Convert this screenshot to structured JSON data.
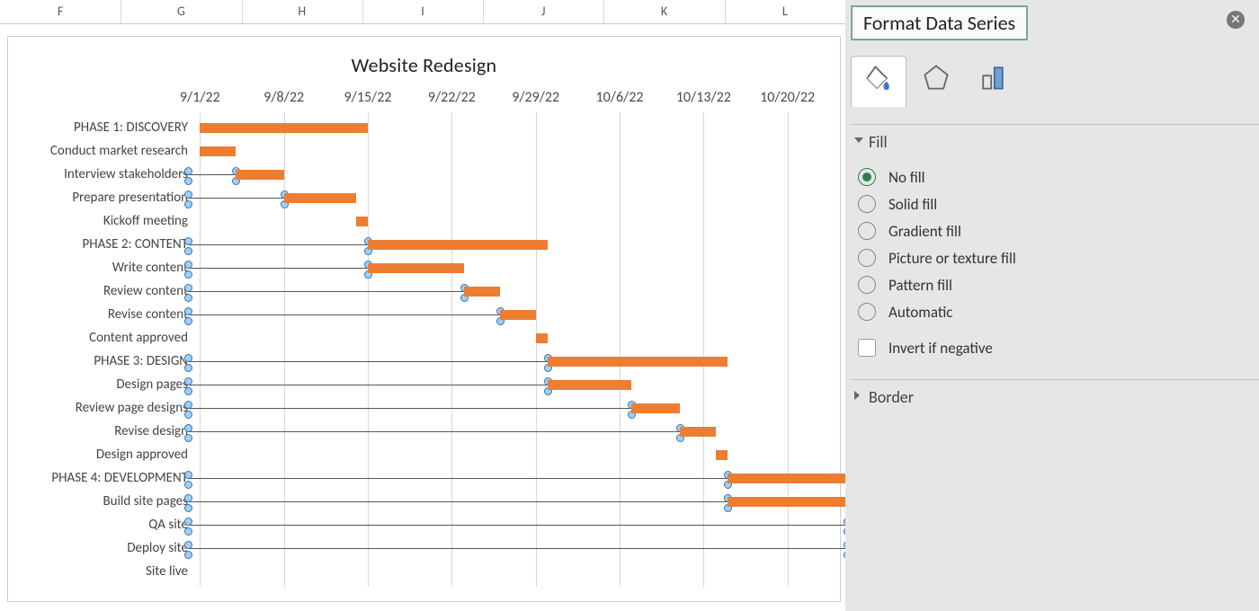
{
  "columns": [
    "F",
    "G",
    "H",
    "I",
    "J",
    "K",
    "L"
  ],
  "panel": {
    "title": "Format Data Series",
    "sections": {
      "fill": "Fill",
      "border": "Border"
    },
    "fill_options": [
      "No fill",
      "Solid fill",
      "Gradient fill",
      "Picture or texture fill",
      "Pattern fill",
      "Automatic"
    ],
    "fill_selected": 0,
    "invert": "Invert if negative"
  },
  "chart_data": {
    "type": "bar",
    "title": "Website Redesign",
    "xlabel": "",
    "ylabel": "",
    "x_ticks": [
      "9/1/22",
      "9/8/22",
      "9/15/22",
      "9/22/22",
      "9/29/22",
      "10/6/22",
      "10/13/22",
      "10/20/22"
    ],
    "x_range": [
      "2022-08-31",
      "2022-10-24"
    ],
    "tasks": [
      {
        "name": "PHASE 1: DISCOVERY",
        "start": "2022-09-01",
        "days": 14,
        "lead": false
      },
      {
        "name": "Conduct market research",
        "start": "2022-09-01",
        "days": 3,
        "lead": false
      },
      {
        "name": "Interview stakeholders",
        "start": "2022-09-04",
        "days": 4,
        "lead": true
      },
      {
        "name": "Prepare presentation",
        "start": "2022-09-08",
        "days": 6,
        "lead": true
      },
      {
        "name": "Kickoff meeting",
        "start": "2022-09-14",
        "days": 1,
        "lead": false
      },
      {
        "name": "PHASE 2: CONTENT",
        "start": "2022-09-15",
        "days": 15,
        "lead": true
      },
      {
        "name": "Write content",
        "start": "2022-09-15",
        "days": 8,
        "lead": true
      },
      {
        "name": "Review content",
        "start": "2022-09-23",
        "days": 3,
        "lead": true
      },
      {
        "name": "Revise content",
        "start": "2022-09-26",
        "days": 3,
        "lead": true
      },
      {
        "name": "Content approved",
        "start": "2022-09-29",
        "days": 1,
        "lead": false
      },
      {
        "name": "PHASE 3: DESIGN",
        "start": "2022-09-30",
        "days": 15,
        "lead": true
      },
      {
        "name": "Design pages",
        "start": "2022-09-30",
        "days": 7,
        "lead": true
      },
      {
        "name": "Review page designs",
        "start": "2022-10-07",
        "days": 4,
        "lead": true
      },
      {
        "name": "Revise design",
        "start": "2022-10-11",
        "days": 3,
        "lead": true
      },
      {
        "name": "Design approved",
        "start": "2022-10-14",
        "days": 1,
        "lead": false
      },
      {
        "name": "PHASE 4: DEVELOPMENT",
        "start": "2022-10-15",
        "days": 15,
        "lead": true
      },
      {
        "name": "Build site pages",
        "start": "2022-10-15",
        "days": 10,
        "lead": true
      },
      {
        "name": "QA site",
        "start": "2022-10-25",
        "days": 0,
        "lead": true
      },
      {
        "name": "Deploy site",
        "start": "2022-10-25",
        "days": 0,
        "lead": true
      },
      {
        "name": "Site live",
        "start": "2022-10-25",
        "days": 0,
        "lead": false
      }
    ]
  }
}
